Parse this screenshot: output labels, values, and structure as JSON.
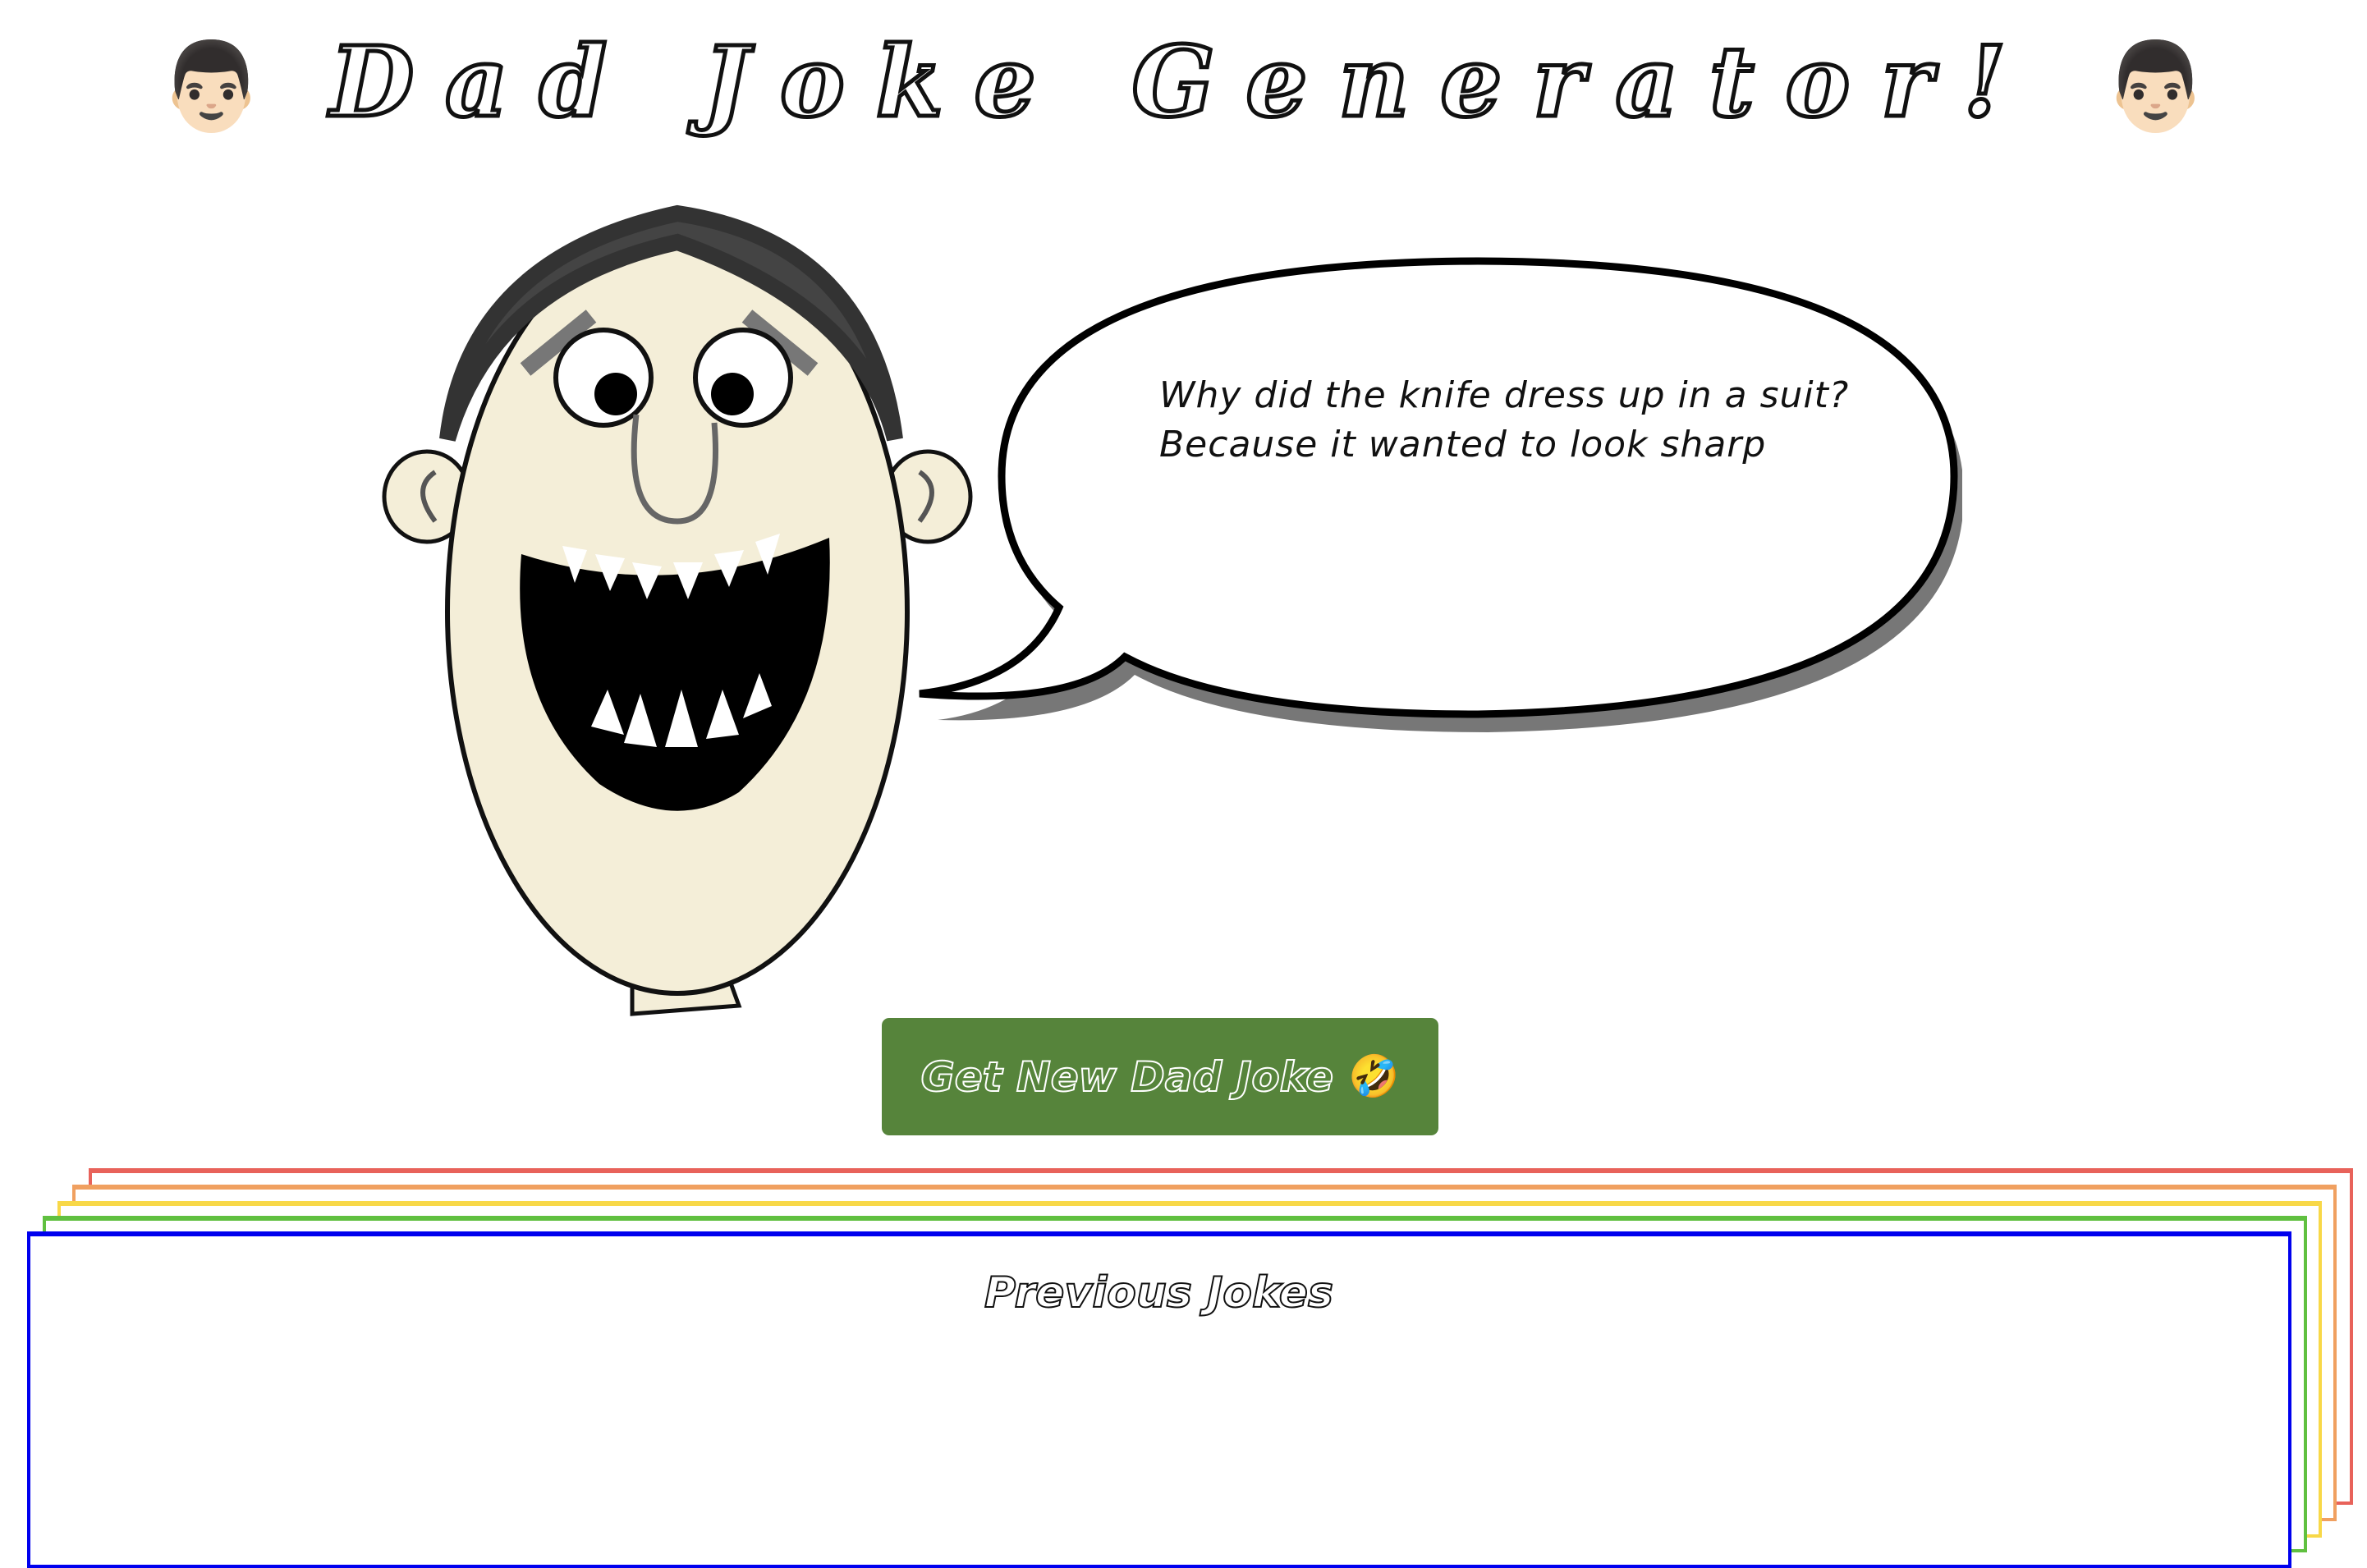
{
  "header": {
    "title": "Dad Joke Generator!",
    "emoji_left": "👨🏻",
    "emoji_right": "👨🏻"
  },
  "joke": {
    "setup": "Why did the knife dress up in a suit?",
    "punchline": "Because it wanted to look sharp"
  },
  "button": {
    "label": "Get New Dad Joke",
    "emoji": "🤣",
    "color": "#56843b"
  },
  "previous": {
    "heading": "Previous Jokes",
    "frame_colors": [
      "#e8625a",
      "#f0a060",
      "#f8d848",
      "#60c040",
      "#0000ee"
    ]
  }
}
